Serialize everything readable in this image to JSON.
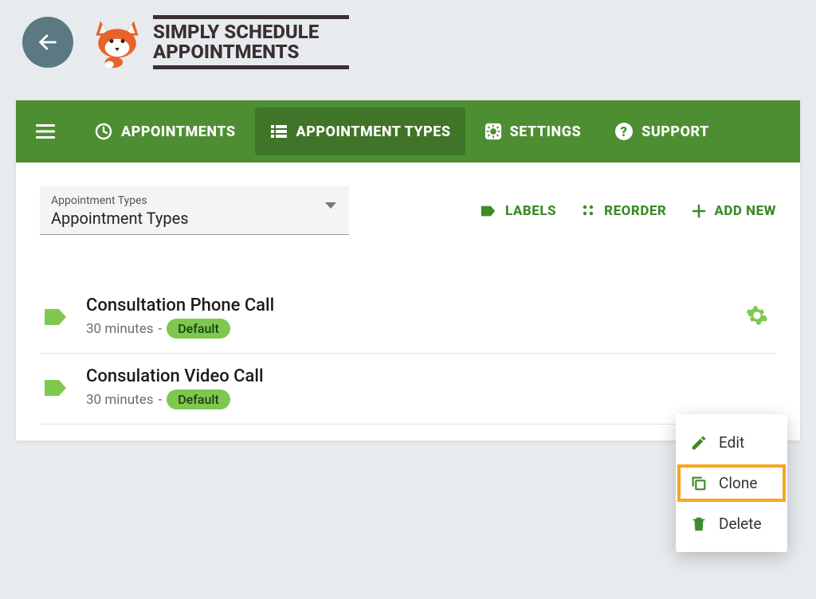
{
  "colors": {
    "brand_green": "#4e8e33",
    "accent_green": "#3d8b2a",
    "pill_green": "#7ec850",
    "back_circle": "#5a7983",
    "highlight_orange": "#f5a623",
    "logo_dark": "#3a2f33"
  },
  "logo": {
    "line1": "SIMPLY SCHEDULE",
    "line2": "APPOINTMENTS"
  },
  "nav": {
    "items": [
      {
        "icon": "clock-icon",
        "label": "APPOINTMENTS"
      },
      {
        "icon": "list-icon",
        "label": "APPOINTMENT TYPES",
        "active": true
      },
      {
        "icon": "gear-box-icon",
        "label": "SETTINGS"
      },
      {
        "icon": "help-icon",
        "label": "SUPPORT"
      }
    ]
  },
  "filter": {
    "label": "Appointment Types",
    "value": "Appointment Types"
  },
  "actions": {
    "labels": "LABELS",
    "reorder": "REORDER",
    "add_new": "ADD NEW"
  },
  "appointment_types": [
    {
      "title": "Consultation Phone Call",
      "duration": "30 minutes",
      "badge": "Default"
    },
    {
      "title": "Consulation Video Call",
      "duration": "30 minutes",
      "badge": "Default"
    }
  ],
  "context_menu": {
    "edit": "Edit",
    "clone": "Clone",
    "delete": "Delete",
    "highlighted": "clone"
  }
}
